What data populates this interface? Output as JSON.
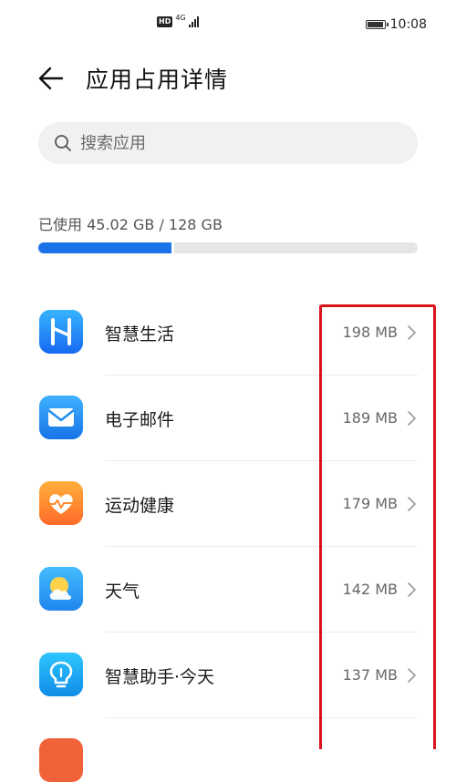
{
  "status_bar": {
    "hd_label": "HD",
    "network_label": "4G",
    "time": "10:08"
  },
  "header": {
    "title": "应用占用详情"
  },
  "search": {
    "placeholder": "搜索应用"
  },
  "storage": {
    "label": "已使用 45.02 GB / 128 GB",
    "used_fraction": 0.352
  },
  "apps": [
    {
      "name": "智慧生活",
      "size": "198 MB",
      "icon": "smart-life-icon",
      "color": "#1e88ff"
    },
    {
      "name": "电子邮件",
      "size": "189 MB",
      "icon": "email-icon",
      "color": "#1f8cf0"
    },
    {
      "name": "运动健康",
      "size": "179 MB",
      "icon": "health-icon",
      "color": "#ff8a2b"
    },
    {
      "name": "天气",
      "size": "142 MB",
      "icon": "weather-icon",
      "color": "#2aa3f5"
    },
    {
      "name": "智慧助手·今天",
      "size": "137 MB",
      "icon": "assistant-icon",
      "color": "#16a8f0"
    }
  ],
  "colors": {
    "accent": "#1a73e8",
    "highlight": "#d9141c"
  }
}
